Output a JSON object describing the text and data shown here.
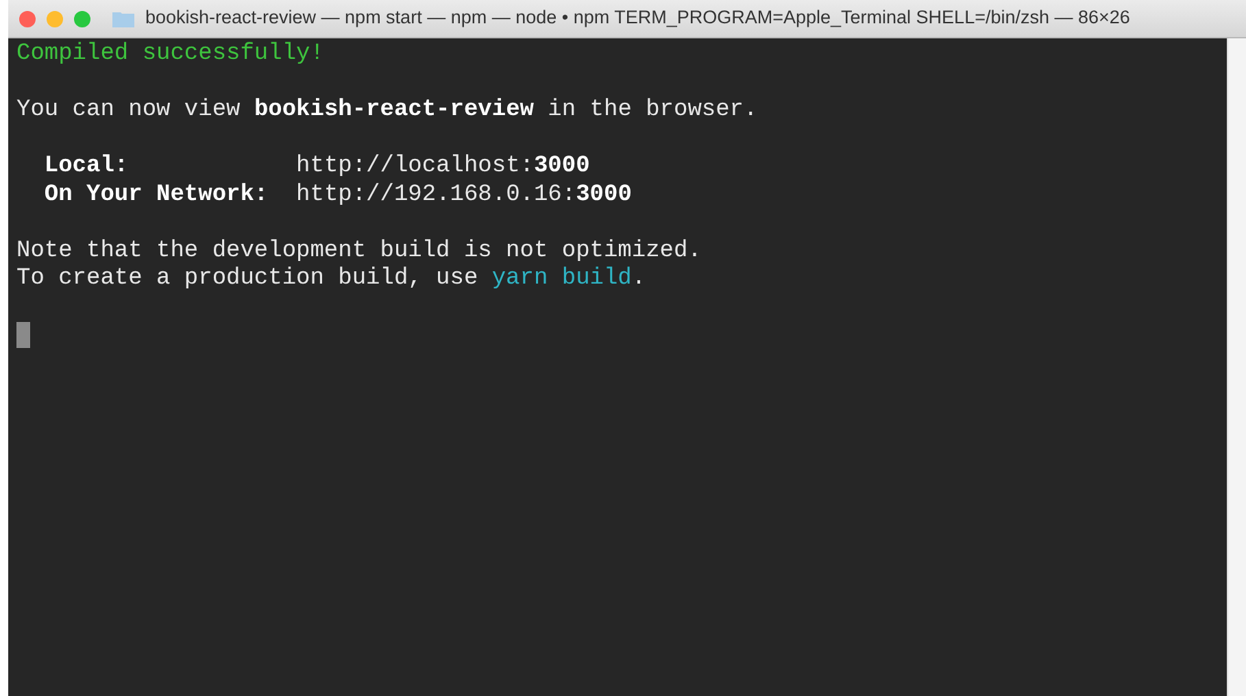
{
  "window": {
    "title": "bookish-react-review — npm start — npm — node • npm TERM_PROGRAM=Apple_Terminal SHELL=/bin/zsh — 86×26"
  },
  "terminal": {
    "lines": [
      {
        "kind": "text",
        "segments": [
          {
            "text": "Compiled successfully!",
            "kind": "green"
          }
        ]
      },
      {
        "kind": "blank"
      },
      {
        "kind": "text",
        "segments": [
          {
            "text": "You can now view ",
            "kind": "plain"
          },
          {
            "text": "bookish-react-review",
            "kind": "bold"
          },
          {
            "text": " in the browser.",
            "kind": "plain"
          }
        ]
      },
      {
        "kind": "blank"
      },
      {
        "kind": "text",
        "segments": [
          {
            "text": "  Local:            ",
            "kind": "bold"
          },
          {
            "text": "http://localhost:",
            "kind": "plain"
          },
          {
            "text": "3000",
            "kind": "bold"
          }
        ]
      },
      {
        "kind": "text",
        "segments": [
          {
            "text": "  On Your Network:  ",
            "kind": "bold"
          },
          {
            "text": "http://192.168.0.16:",
            "kind": "plain"
          },
          {
            "text": "3000",
            "kind": "bold"
          }
        ]
      },
      {
        "kind": "blank"
      },
      {
        "kind": "text",
        "segments": [
          {
            "text": "Note that the development build is not optimized.",
            "kind": "plain"
          }
        ]
      },
      {
        "kind": "text",
        "segments": [
          {
            "text": "To create a production build, use ",
            "kind": "plain"
          },
          {
            "text": "yarn build",
            "kind": "cyan"
          },
          {
            "text": ".",
            "kind": "plain"
          }
        ]
      },
      {
        "kind": "blank"
      }
    ],
    "cursor": true
  }
}
